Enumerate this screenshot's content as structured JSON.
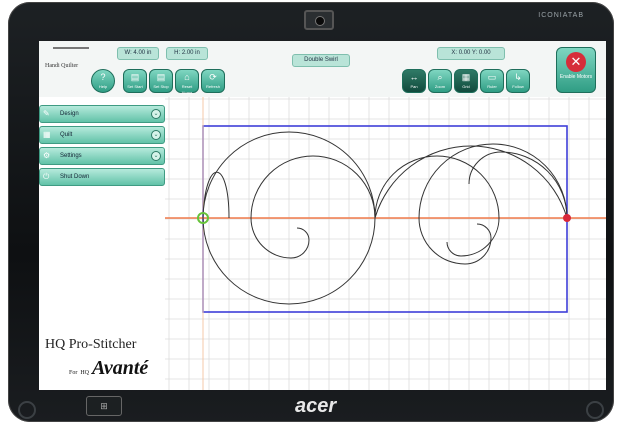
{
  "device": {
    "brand": "ICONIATAB",
    "logo": "acer",
    "home_key_icon": "windows-icon"
  },
  "toolbar": {
    "width_readout": "W: 4.00 in",
    "height_readout": "H: 2.00 in",
    "pattern_name": "Double Swirl",
    "coords_readout": "X: 0.00  Y: 0.00",
    "app_logo": "Handi Quilter",
    "help": "Help",
    "left_buttons": [
      {
        "label": "Set Start",
        "icon": "start-icon"
      },
      {
        "label": "Set Stop",
        "icon": "stop-icon"
      },
      {
        "label": "Reset Home",
        "icon": "home-icon"
      },
      {
        "label": "Refresh",
        "icon": "refresh-icon"
      }
    ],
    "right_buttons": [
      {
        "label": "Pan",
        "icon": "pan-icon"
      },
      {
        "label": "Zoom",
        "icon": "zoom-icon"
      },
      {
        "label": "Grid",
        "icon": "grid-icon"
      },
      {
        "label": "Ruler",
        "icon": "ruler-icon"
      },
      {
        "label": "Follow",
        "icon": "follow-icon"
      }
    ],
    "enable_motors": "Enable Motors"
  },
  "sidebar": {
    "items": [
      {
        "label": "Design"
      },
      {
        "label": "Quilt"
      },
      {
        "label": "Settings"
      },
      {
        "label": "Shut Down"
      }
    ]
  },
  "branding": {
    "product": "HQ Pro-Stitcher",
    "for": "For",
    "hq": "HQ",
    "machine": "Avanté"
  },
  "colors": {
    "accent": "#5cc2a8",
    "crosshair": "#f07a4a",
    "bounding_box": "#3f3fd8",
    "start_point": "#66c23a",
    "end_point": "#d8283a"
  }
}
